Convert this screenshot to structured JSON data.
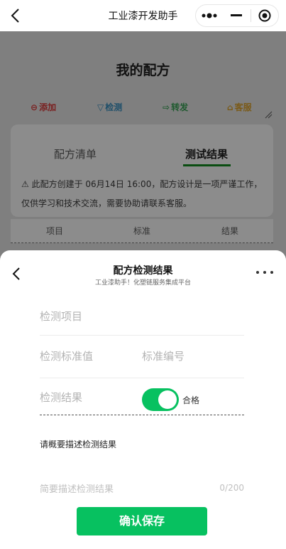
{
  "navbar": {
    "title": "工业漆开发助手"
  },
  "page": {
    "title": "我的配方",
    "actions": [
      {
        "icon": "minus-circle-icon",
        "glyph": "⊖",
        "label": "添加"
      },
      {
        "icon": "filter-icon",
        "glyph": "▽",
        "label": "检测"
      },
      {
        "icon": "share-icon",
        "glyph": "⇨",
        "label": "转发"
      },
      {
        "icon": "service-icon",
        "glyph": "⌂",
        "label": "客服"
      }
    ],
    "tabs": [
      "配方清单",
      "测试结果"
    ],
    "notice": "⚠ 此配方创建于 06月14日 16:00，配方设计是一项严谨工作，仅供学习和技术交流，需要协助请联系客服。",
    "table_headers": [
      "项目",
      "标准",
      "结果"
    ]
  },
  "sheet": {
    "title": "配方检测结果",
    "subtitle": "工业漆助手！化塑链服务集成平台",
    "fields": {
      "item_placeholder": "检测项目",
      "standard_value_placeholder": "检测标准值",
      "standard_code_placeholder": "标准编号",
      "result_label": "检测结果",
      "result_toggle_text": "合格",
      "description_label": "请概要描述检测结果",
      "description_placeholder": "简要描述检测结果",
      "description_counter": "0/200"
    },
    "save_label": "确认保存"
  },
  "colors": {
    "accent": "#07c160",
    "tab_underline": "#0b4d12"
  }
}
